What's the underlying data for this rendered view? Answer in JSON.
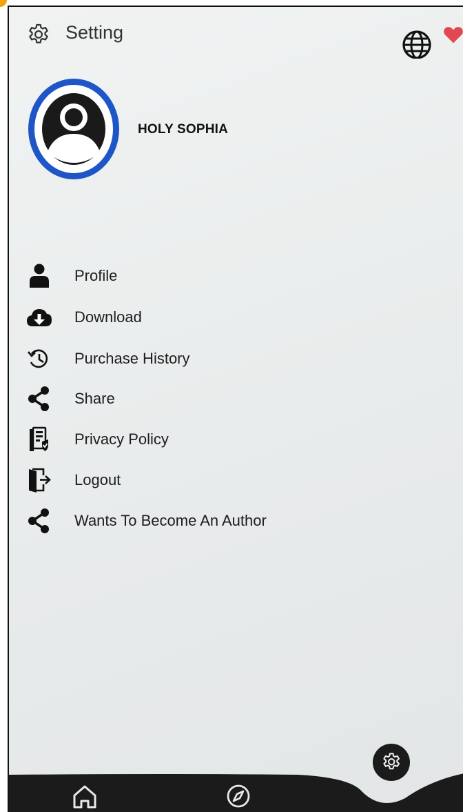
{
  "header": {
    "title": "Setting"
  },
  "profile": {
    "name": "HOLY SOPHIA"
  },
  "menu": [
    {
      "label": "Profile",
      "icon": "user-icon"
    },
    {
      "label": "Download",
      "icon": "cloud-download-icon"
    },
    {
      "label": "Purchase History",
      "icon": "history-icon"
    },
    {
      "label": "Share",
      "icon": "share-icon"
    },
    {
      "label": "Privacy Policy",
      "icon": "privacy-policy-icon"
    },
    {
      "label": "Logout",
      "icon": "logout-icon"
    },
    {
      "label": "Wants To Become An Author",
      "icon": "share-icon"
    }
  ],
  "bottom_nav": [
    {
      "icon": "home-icon"
    },
    {
      "icon": "compass-icon"
    },
    {
      "icon": "gear-icon",
      "active": true
    }
  ],
  "colors": {
    "avatar_ring": "#1e56c8",
    "heart": "#e0494f",
    "nav_bar": "#1c1b1b",
    "text": "#1d1d1d"
  }
}
